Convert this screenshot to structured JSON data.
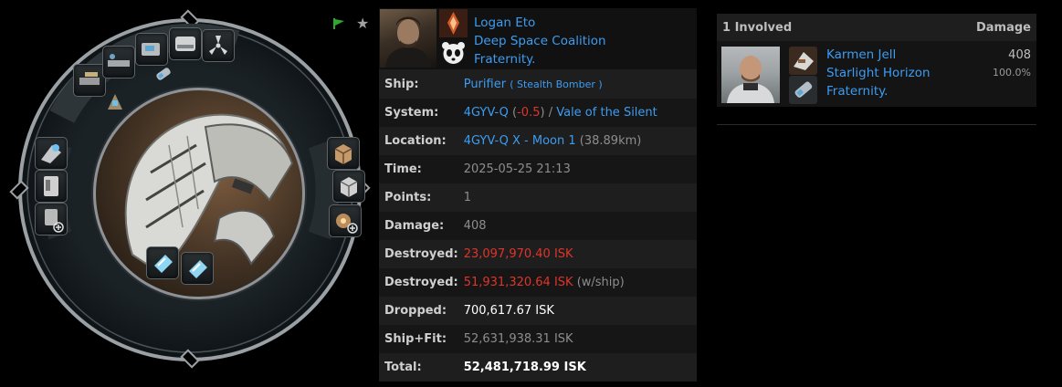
{
  "header_icons": {
    "flag": "green-flag-icon",
    "star": "★"
  },
  "victim": {
    "name": "Logan Eto",
    "corporation": "Deep Space Coalition",
    "alliance": "Fraternity."
  },
  "details": {
    "ship_label": "Ship:",
    "ship_name": "Purifier",
    "ship_class": "( Stealth Bomber )",
    "system_label": "System:",
    "system_name": "4GYV-Q",
    "security": "-0.5",
    "region": "Vale of the Silent",
    "location_label": "Location:",
    "location_name": "4GYV-Q X - Moon 1",
    "location_distance": "(38.89km)",
    "time_label": "Time:",
    "time_value": "2025-05-25 21:13",
    "points_label": "Points:",
    "points_value": "1",
    "damage_label": "Damage:",
    "damage_value": "408",
    "destroyed_label": "Destroyed:",
    "destroyed_value": "23,097,970.40 ISK",
    "destroyed_ship_label": "Destroyed:",
    "destroyed_ship_value": "51,931,320.64 ISK",
    "destroyed_ship_note": "(w/ship)",
    "dropped_label": "Dropped:",
    "dropped_value": "700,617.67 ISK",
    "shipfit_label": "Ship+Fit:",
    "shipfit_value": "52,631,938.31 ISK",
    "total_label": "Total:",
    "total_value": "52,481,718.99 ISK"
  },
  "involved": {
    "header_count": "1 Involved",
    "header_damage": "Damage",
    "attackers": [
      {
        "name": "Karmen Jell",
        "corporation": "Starlight Horizon",
        "alliance": "Fraternity.",
        "damage": "408",
        "percent": "100.0%"
      }
    ]
  },
  "colors": {
    "link": "#3d9cf0",
    "destroyed": "#e0342b",
    "security": "#e0342b"
  }
}
